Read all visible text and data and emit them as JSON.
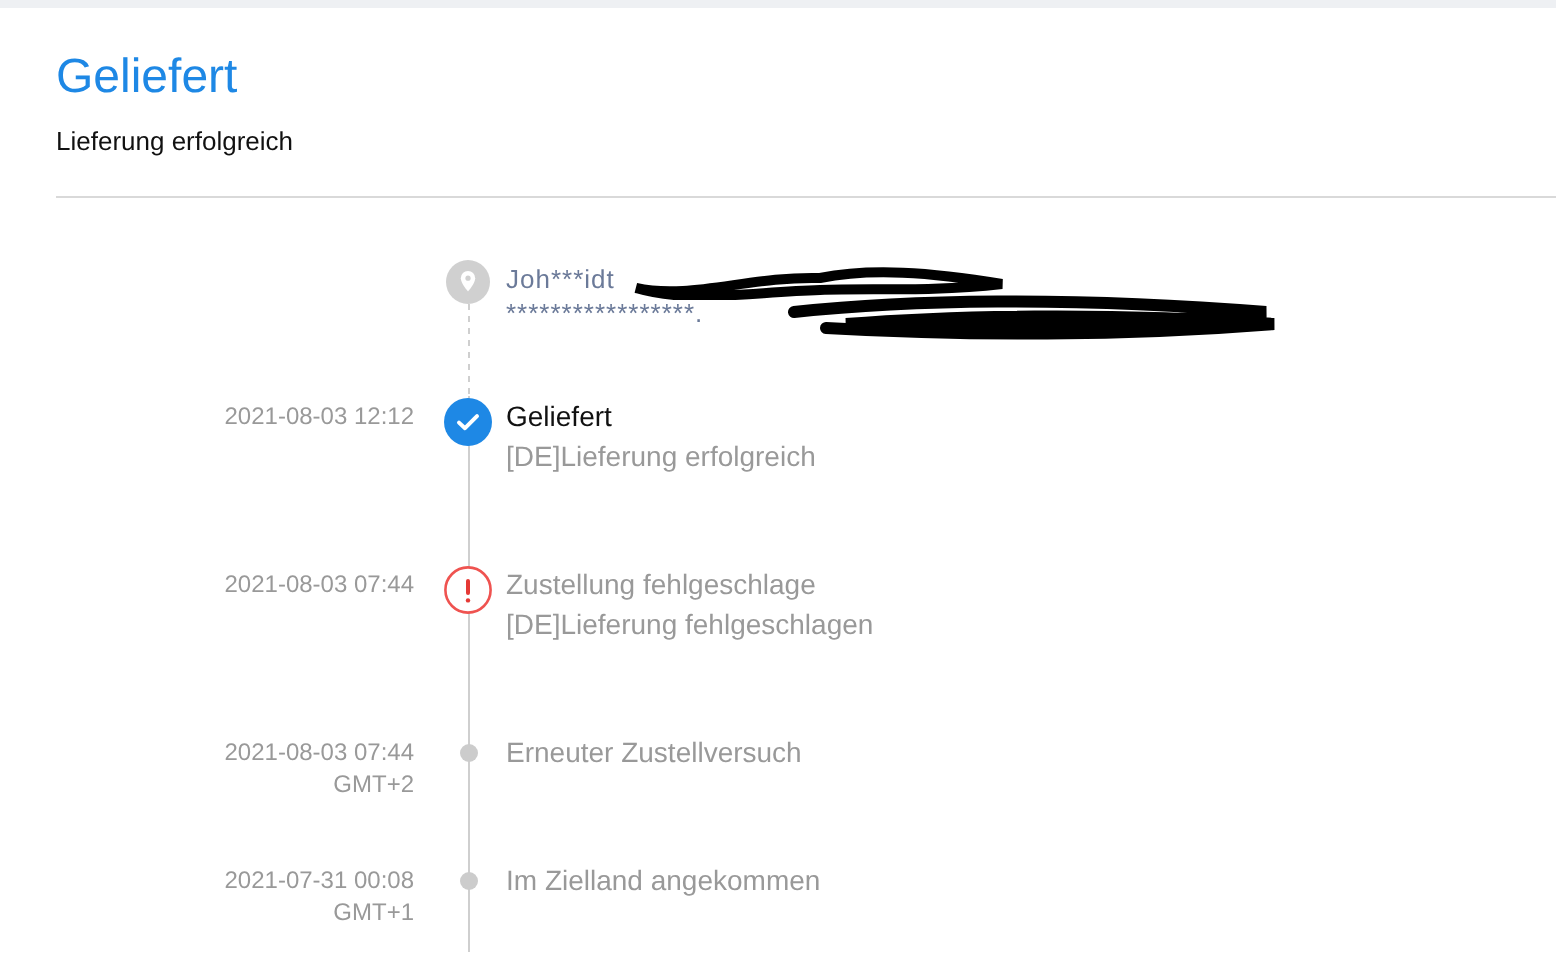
{
  "header": {
    "title": "Geliefert",
    "subtitle": "Lieferung erfolgreich"
  },
  "address": {
    "lines": [
      "Joh***idt",
      "*****************."
    ]
  },
  "events": [
    {
      "kind": "delivered",
      "time": "2021-08-03 12:12",
      "title": "Geliefert",
      "detail": "[DE]Lieferung erfolgreich"
    },
    {
      "kind": "failed",
      "time": "2021-08-03 07:44",
      "title": "Zustellung fehlgeschlage",
      "detail": "[DE]Lieferung fehlgeschlagen"
    },
    {
      "kind": "normal",
      "time": "2021-08-03 07:44",
      "timezone": "GMT+2",
      "title": "Erneuter Zustellversuch"
    },
    {
      "kind": "normal",
      "time": "2021-07-31 00:08",
      "timezone": "GMT+1",
      "title": "Im Zielland angekommen"
    }
  ]
}
